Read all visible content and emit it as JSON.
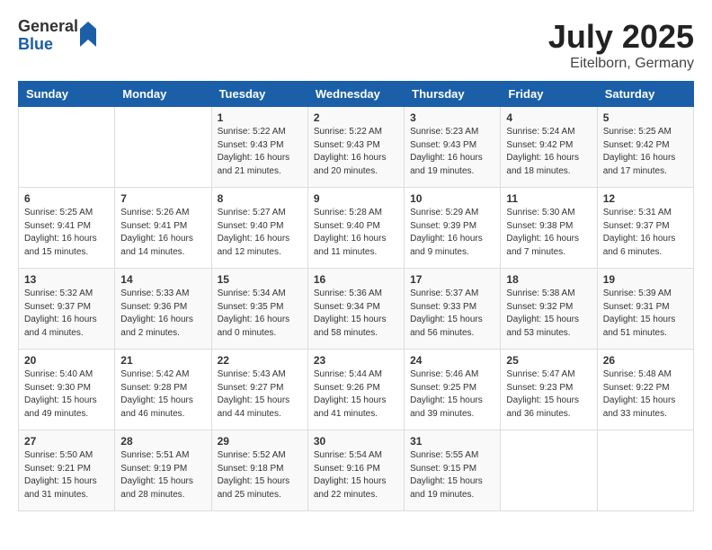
{
  "header": {
    "logo": {
      "general": "General",
      "blue": "Blue"
    },
    "title": "July 2025",
    "subtitle": "Eitelborn, Germany"
  },
  "days_of_week": [
    "Sunday",
    "Monday",
    "Tuesday",
    "Wednesday",
    "Thursday",
    "Friday",
    "Saturday"
  ],
  "weeks": [
    [
      {
        "day": "",
        "details": ""
      },
      {
        "day": "",
        "details": ""
      },
      {
        "day": "1",
        "details": "Sunrise: 5:22 AM\nSunset: 9:43 PM\nDaylight: 16 hours\nand 21 minutes."
      },
      {
        "day": "2",
        "details": "Sunrise: 5:22 AM\nSunset: 9:43 PM\nDaylight: 16 hours\nand 20 minutes."
      },
      {
        "day": "3",
        "details": "Sunrise: 5:23 AM\nSunset: 9:43 PM\nDaylight: 16 hours\nand 19 minutes."
      },
      {
        "day": "4",
        "details": "Sunrise: 5:24 AM\nSunset: 9:42 PM\nDaylight: 16 hours\nand 18 minutes."
      },
      {
        "day": "5",
        "details": "Sunrise: 5:25 AM\nSunset: 9:42 PM\nDaylight: 16 hours\nand 17 minutes."
      }
    ],
    [
      {
        "day": "6",
        "details": "Sunrise: 5:25 AM\nSunset: 9:41 PM\nDaylight: 16 hours\nand 15 minutes."
      },
      {
        "day": "7",
        "details": "Sunrise: 5:26 AM\nSunset: 9:41 PM\nDaylight: 16 hours\nand 14 minutes."
      },
      {
        "day": "8",
        "details": "Sunrise: 5:27 AM\nSunset: 9:40 PM\nDaylight: 16 hours\nand 12 minutes."
      },
      {
        "day": "9",
        "details": "Sunrise: 5:28 AM\nSunset: 9:40 PM\nDaylight: 16 hours\nand 11 minutes."
      },
      {
        "day": "10",
        "details": "Sunrise: 5:29 AM\nSunset: 9:39 PM\nDaylight: 16 hours\nand 9 minutes."
      },
      {
        "day": "11",
        "details": "Sunrise: 5:30 AM\nSunset: 9:38 PM\nDaylight: 16 hours\nand 7 minutes."
      },
      {
        "day": "12",
        "details": "Sunrise: 5:31 AM\nSunset: 9:37 PM\nDaylight: 16 hours\nand 6 minutes."
      }
    ],
    [
      {
        "day": "13",
        "details": "Sunrise: 5:32 AM\nSunset: 9:37 PM\nDaylight: 16 hours\nand 4 minutes."
      },
      {
        "day": "14",
        "details": "Sunrise: 5:33 AM\nSunset: 9:36 PM\nDaylight: 16 hours\nand 2 minutes."
      },
      {
        "day": "15",
        "details": "Sunrise: 5:34 AM\nSunset: 9:35 PM\nDaylight: 16 hours\nand 0 minutes."
      },
      {
        "day": "16",
        "details": "Sunrise: 5:36 AM\nSunset: 9:34 PM\nDaylight: 15 hours\nand 58 minutes."
      },
      {
        "day": "17",
        "details": "Sunrise: 5:37 AM\nSunset: 9:33 PM\nDaylight: 15 hours\nand 56 minutes."
      },
      {
        "day": "18",
        "details": "Sunrise: 5:38 AM\nSunset: 9:32 PM\nDaylight: 15 hours\nand 53 minutes."
      },
      {
        "day": "19",
        "details": "Sunrise: 5:39 AM\nSunset: 9:31 PM\nDaylight: 15 hours\nand 51 minutes."
      }
    ],
    [
      {
        "day": "20",
        "details": "Sunrise: 5:40 AM\nSunset: 9:30 PM\nDaylight: 15 hours\nand 49 minutes."
      },
      {
        "day": "21",
        "details": "Sunrise: 5:42 AM\nSunset: 9:28 PM\nDaylight: 15 hours\nand 46 minutes."
      },
      {
        "day": "22",
        "details": "Sunrise: 5:43 AM\nSunset: 9:27 PM\nDaylight: 15 hours\nand 44 minutes."
      },
      {
        "day": "23",
        "details": "Sunrise: 5:44 AM\nSunset: 9:26 PM\nDaylight: 15 hours\nand 41 minutes."
      },
      {
        "day": "24",
        "details": "Sunrise: 5:46 AM\nSunset: 9:25 PM\nDaylight: 15 hours\nand 39 minutes."
      },
      {
        "day": "25",
        "details": "Sunrise: 5:47 AM\nSunset: 9:23 PM\nDaylight: 15 hours\nand 36 minutes."
      },
      {
        "day": "26",
        "details": "Sunrise: 5:48 AM\nSunset: 9:22 PM\nDaylight: 15 hours\nand 33 minutes."
      }
    ],
    [
      {
        "day": "27",
        "details": "Sunrise: 5:50 AM\nSunset: 9:21 PM\nDaylight: 15 hours\nand 31 minutes."
      },
      {
        "day": "28",
        "details": "Sunrise: 5:51 AM\nSunset: 9:19 PM\nDaylight: 15 hours\nand 28 minutes."
      },
      {
        "day": "29",
        "details": "Sunrise: 5:52 AM\nSunset: 9:18 PM\nDaylight: 15 hours\nand 25 minutes."
      },
      {
        "day": "30",
        "details": "Sunrise: 5:54 AM\nSunset: 9:16 PM\nDaylight: 15 hours\nand 22 minutes."
      },
      {
        "day": "31",
        "details": "Sunrise: 5:55 AM\nSunset: 9:15 PM\nDaylight: 15 hours\nand 19 minutes."
      },
      {
        "day": "",
        "details": ""
      },
      {
        "day": "",
        "details": ""
      }
    ]
  ]
}
